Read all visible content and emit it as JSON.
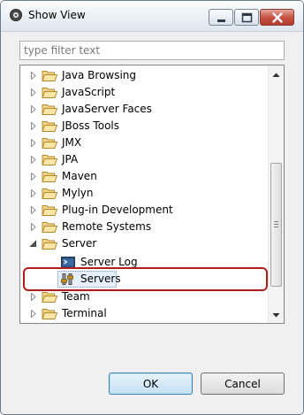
{
  "window": {
    "title": "Show View"
  },
  "filter": {
    "placeholder": "type filter text",
    "value": ""
  },
  "tree": {
    "items": [
      {
        "label": "Java Browsing",
        "icon": "folder-icon",
        "expanded": false,
        "level": 0
      },
      {
        "label": "JavaScript",
        "icon": "folder-icon",
        "expanded": false,
        "level": 0
      },
      {
        "label": "JavaServer Faces",
        "icon": "folder-icon",
        "expanded": false,
        "level": 0
      },
      {
        "label": "JBoss Tools",
        "icon": "folder-icon",
        "expanded": false,
        "level": 0
      },
      {
        "label": "JMX",
        "icon": "folder-icon",
        "expanded": false,
        "level": 0
      },
      {
        "label": "JPA",
        "icon": "folder-icon",
        "expanded": false,
        "level": 0
      },
      {
        "label": "Maven",
        "icon": "folder-icon",
        "expanded": false,
        "level": 0
      },
      {
        "label": "Mylyn",
        "icon": "folder-icon",
        "expanded": false,
        "level": 0
      },
      {
        "label": "Plug-in Development",
        "icon": "folder-icon",
        "expanded": false,
        "level": 0
      },
      {
        "label": "Remote Systems",
        "icon": "folder-icon",
        "expanded": false,
        "level": 0
      },
      {
        "label": "Server",
        "icon": "folder-icon",
        "expanded": true,
        "level": 0
      },
      {
        "label": "Server Log",
        "icon": "server-log-icon",
        "level": 1
      },
      {
        "label": "Servers",
        "icon": "servers-icon",
        "level": 1,
        "selected": true
      },
      {
        "label": "Team",
        "icon": "folder-icon",
        "expanded": false,
        "level": 0
      },
      {
        "label": "Terminal",
        "icon": "folder-icon",
        "expanded": false,
        "level": 0
      }
    ]
  },
  "buttons": {
    "ok": "OK",
    "cancel": "Cancel"
  },
  "colors": {
    "highlight_border": "#b01e1e",
    "folder_fill": "#f5d58a",
    "selection_bg": "#e6f0fc"
  }
}
